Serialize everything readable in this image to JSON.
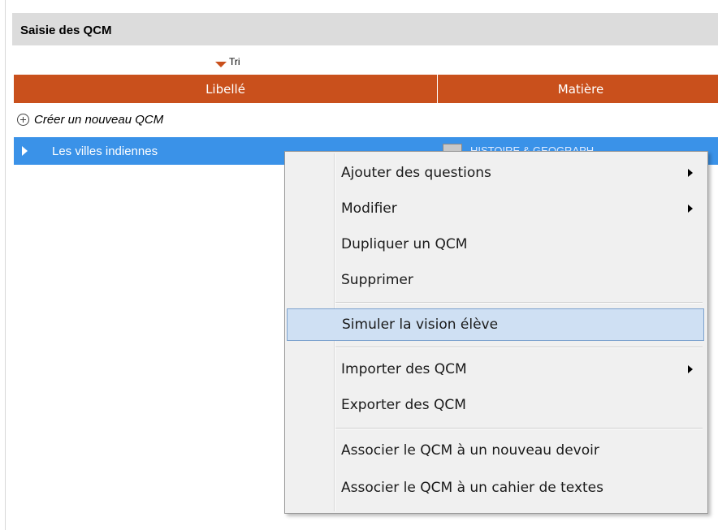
{
  "panel": {
    "title": "Saisie des QCM"
  },
  "sort": {
    "label": "Tri"
  },
  "table": {
    "headers": [
      "Libellé",
      "Matière"
    ],
    "create_label": "Créer un nouveau QCM",
    "selected_row": {
      "label": "Les villes indiennes",
      "subject": "HISTOIRE & GEOGRAPH..."
    }
  },
  "context_menu": {
    "items": [
      {
        "label": "Ajouter des questions",
        "submenu": true
      },
      {
        "label": "Modifier",
        "submenu": true
      },
      {
        "label": "Dupliquer un QCM",
        "submenu": false
      },
      {
        "label": "Supprimer",
        "submenu": false
      },
      {
        "label": "Simuler la vision élève",
        "submenu": false,
        "highlighted": true
      },
      {
        "label": "Importer des QCM",
        "submenu": true
      },
      {
        "label": "Exporter des QCM",
        "submenu": false
      },
      {
        "label": "Associer le QCM à un nouveau devoir",
        "submenu": false
      },
      {
        "label": "Associer le QCM à un cahier de textes",
        "submenu": false
      }
    ]
  },
  "colors": {
    "header": "#c9501c",
    "selection": "#3a92e8",
    "menu_highlight": "#cfe0f3"
  }
}
